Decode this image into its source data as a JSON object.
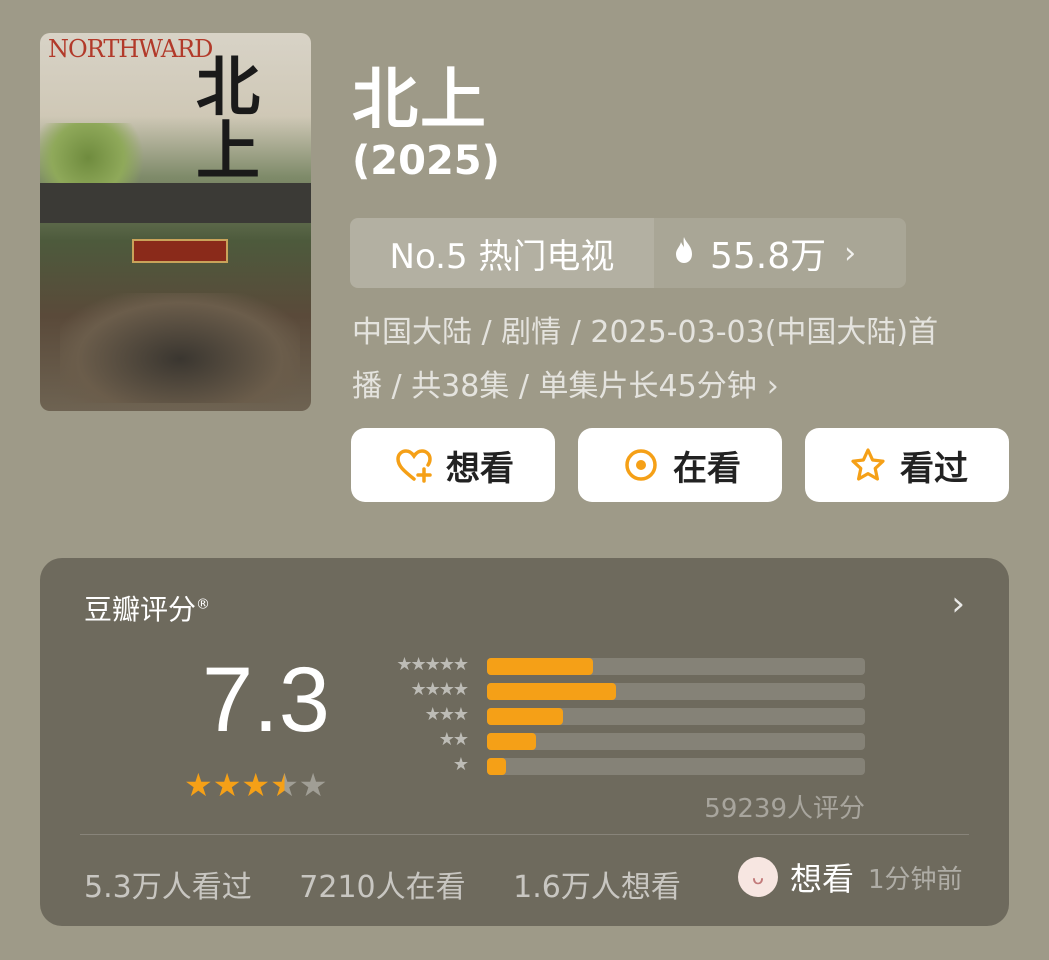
{
  "poster": {
    "title_text": "NORTHWARD",
    "big_text": "北上",
    "sign_text": "运河人家"
  },
  "title": "北上",
  "year": "(2025)",
  "rank": {
    "label": "No.5 热门电视",
    "heat": "55.8万"
  },
  "meta": {
    "line1": "中国大陆 / 剧情 / 2025-03-03(中国大陆)首",
    "line2": "播 / 共38集 / 单集片长45分钟"
  },
  "buttons": {
    "want": "想看",
    "watching": "在看",
    "watched": "看过"
  },
  "rating": {
    "label": "豆瓣评分",
    "mark": "®",
    "score": "7.3",
    "stars": 3.5,
    "distribution": [
      {
        "stars": "★★★★★",
        "percent": 28
      },
      {
        "stars": "★★★★",
        "percent": 34
      },
      {
        "stars": "★★★",
        "percent": 20
      },
      {
        "stars": "★★",
        "percent": 13
      },
      {
        "stars": "★",
        "percent": 5
      }
    ],
    "count": "59239人评分"
  },
  "stats": {
    "watched": "5.3万人看过",
    "watching": "7210人在看",
    "want": "1.6万人想看"
  },
  "friend": {
    "action": "想看",
    "time": "1分钟前"
  },
  "colors": {
    "accent": "#f5a017",
    "background": "#9e9a88",
    "card": "#6e6a5d"
  }
}
